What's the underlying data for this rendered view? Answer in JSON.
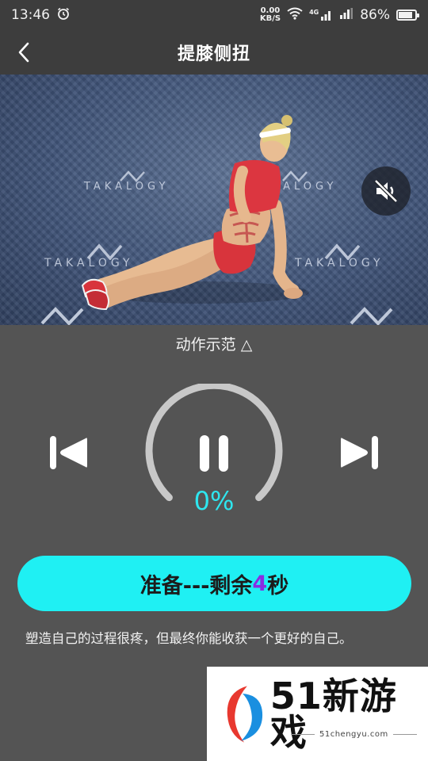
{
  "status_bar": {
    "time": "13:46",
    "net_speed_value": "0.00",
    "net_speed_unit": "KB/S",
    "signal_label_1": "4G",
    "signal_label_2": "il",
    "battery_percent": "86%",
    "battery_level": 0.86,
    "icons": [
      "alarm-icon",
      "wifi-icon",
      "signal-icon",
      "signal-icon",
      "battery-icon"
    ]
  },
  "header": {
    "title": "提膝侧扭",
    "back_icon": "chevron-left-icon"
  },
  "video": {
    "watermark_text": "TAKALOGY",
    "mute_icon": "volume-mute-icon",
    "fullscreen_icon": "fullscreen-icon"
  },
  "demo_label": "动作示范 △",
  "controls": {
    "prev_icon": "skip-previous-icon",
    "next_icon": "skip-next-icon",
    "pause_icon": "pause-icon",
    "progress_percent_text": "0%",
    "progress_value": 0
  },
  "ready_button": {
    "prefix": "准备---剩余",
    "count": "4",
    "suffix": "秒"
  },
  "motto": "塑造自己的过程很疼，但最终你能收获一个更好的自己。",
  "site_watermark": {
    "name": "51新游戏",
    "url": "51chengyu.com"
  },
  "colors": {
    "accent": "#1ff0f3",
    "progress_text": "#2ee6ef",
    "count_highlight": "#8a2be2",
    "background": "#545454",
    "header_bg": "#3d3d3d"
  }
}
